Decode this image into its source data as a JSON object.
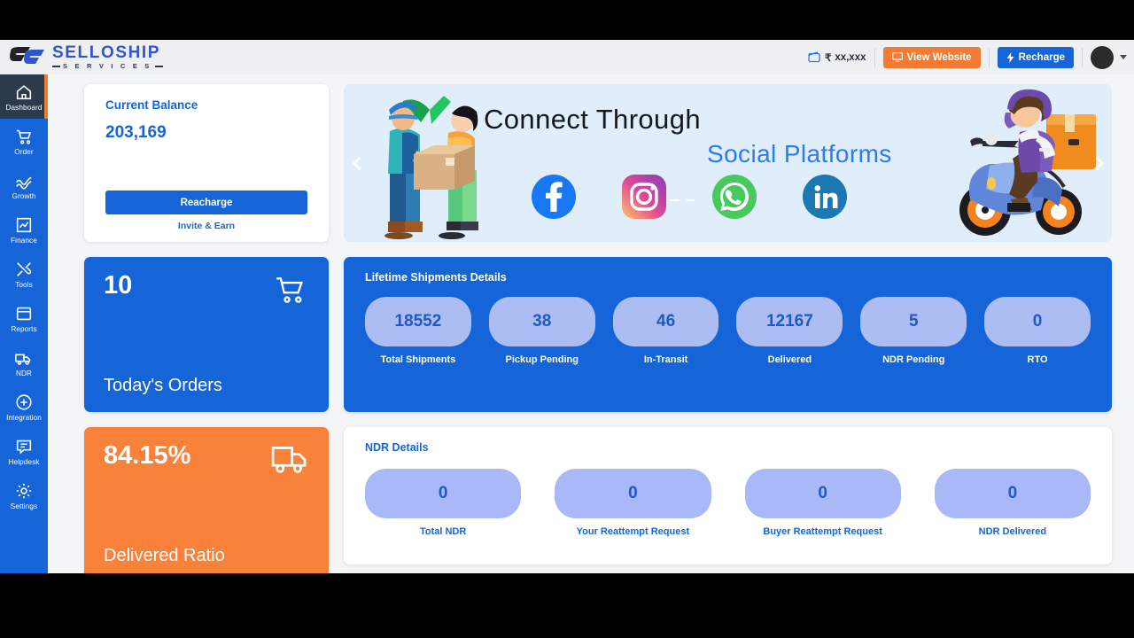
{
  "brand": {
    "name": "SELLOSHIP",
    "sub": "S E R V I C E S",
    "logo_icon": "selloship-logo-icon"
  },
  "header": {
    "wallet_icon": "wallet-icon",
    "currency_symbol": "₹",
    "wallet_amount": "xx,xxx",
    "view_website_label": "View Website",
    "view_website_icon": "monitor-icon",
    "recharge_label": "Recharge",
    "recharge_icon": "lightning-bolt-icon",
    "avatar_icon": "user-avatar",
    "caret_icon": "chevron-down-icon",
    "accent_orange": "#f47b32",
    "accent_blue": "#1565d8"
  },
  "sidebar": {
    "items": [
      {
        "label": "Dashboard",
        "icon": "home-icon",
        "active": true
      },
      {
        "label": "Order",
        "icon": "cart-icon",
        "active": false
      },
      {
        "label": "Growth",
        "icon": "growth-chart-icon",
        "active": false
      },
      {
        "label": "Finance",
        "icon": "finance-icon",
        "active": false
      },
      {
        "label": "Tools",
        "icon": "tools-icon",
        "active": false
      },
      {
        "label": "Reports",
        "icon": "reports-icon",
        "active": false
      },
      {
        "label": "NDR",
        "icon": "truck-icon",
        "active": false
      },
      {
        "label": "Integration",
        "icon": "plus-circle-icon",
        "active": false
      },
      {
        "label": "Helpdesk",
        "icon": "chat-icon",
        "active": false
      },
      {
        "label": "Settings",
        "icon": "gear-icon",
        "active": false
      }
    ]
  },
  "balance_card": {
    "title": "Current Balance",
    "amount": "203,169",
    "recharge_button": "Reacharge",
    "invite_link": "Invite & Earn"
  },
  "banner": {
    "line1": "Connect Through",
    "line2": "Social Platforms",
    "prev_icon": "chevron-left-icon",
    "next_icon": "chevron-right-icon",
    "socials": [
      {
        "name": "facebook-icon"
      },
      {
        "name": "instagram-icon"
      },
      {
        "name": "whatsapp-icon"
      },
      {
        "name": "linkedin-icon"
      }
    ],
    "illustration_left": "delivery-handover-illustration",
    "illustration_right": "scooter-courier-illustration"
  },
  "kpi_cards": [
    {
      "value": "10",
      "label": "Today's Orders",
      "icon": "cart-icon",
      "color": "#1565d8"
    },
    {
      "value": "84.15%",
      "label": "Delivered Ratio",
      "icon": "truck-icon",
      "color": "#f9813a"
    }
  ],
  "shipments": {
    "title": "Lifetime Shipments Details",
    "stats": [
      {
        "value": "18552",
        "label": "Total Shipments"
      },
      {
        "value": "38",
        "label": "Pickup Pending"
      },
      {
        "value": "46",
        "label": "In-Transit"
      },
      {
        "value": "12167",
        "label": "Delivered"
      },
      {
        "value": "5",
        "label": "NDR Pending"
      },
      {
        "value": "0",
        "label": "RTO"
      }
    ]
  },
  "ndr": {
    "title": "NDR Details",
    "stats": [
      {
        "value": "0",
        "label": "Total NDR"
      },
      {
        "value": "0",
        "label": "Your Reattempt Request"
      },
      {
        "value": "0",
        "label": "Buyer Reattempt Request"
      },
      {
        "value": "0",
        "label": "NDR Delivered"
      }
    ]
  }
}
